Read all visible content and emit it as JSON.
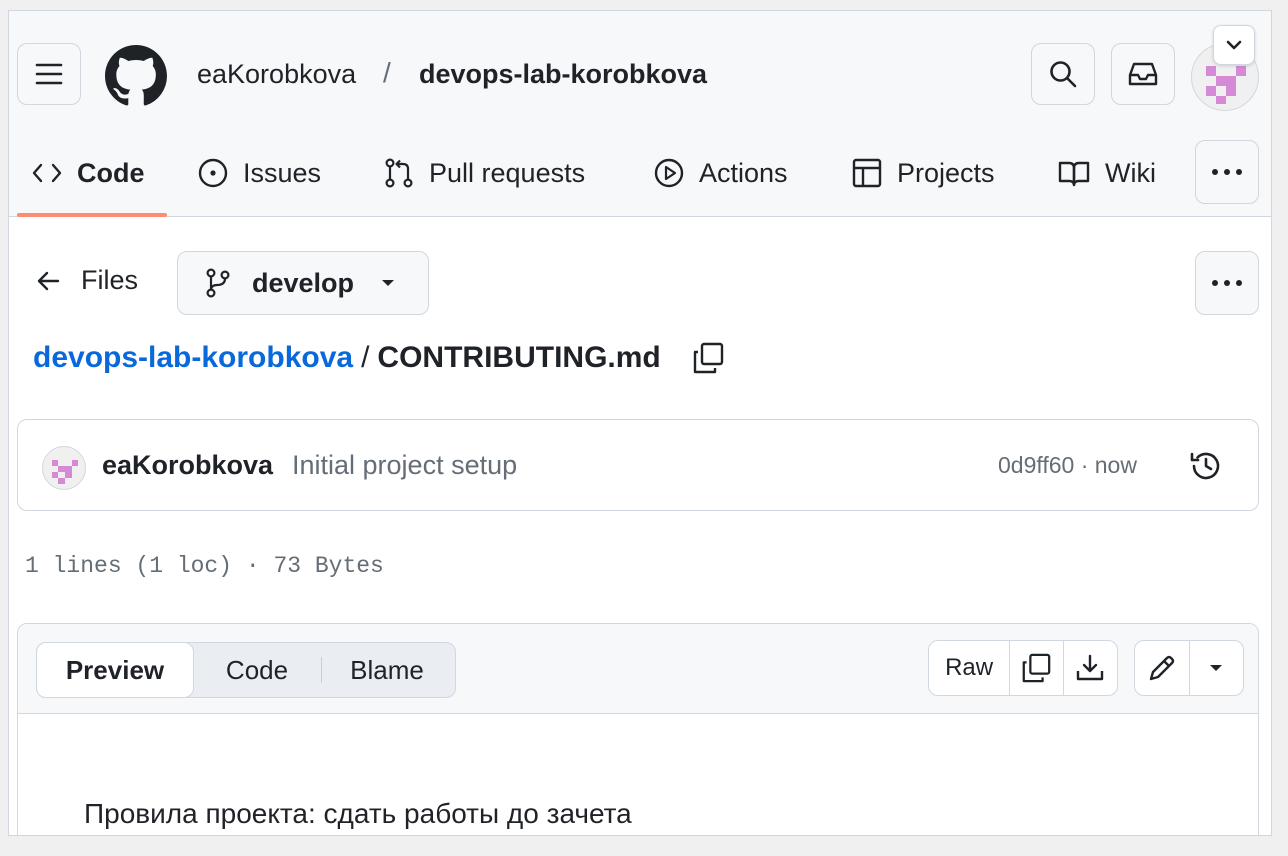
{
  "header": {
    "owner": "eaKorobkova",
    "separator": "/",
    "repo": "devops-lab-korobkova",
    "icons": [
      "hamburger-icon",
      "github-logo-icon",
      "search-icon",
      "inbox-icon",
      "chevron-down-icon"
    ]
  },
  "tabs": [
    {
      "label": "Code",
      "icon": "code-icon",
      "active": true
    },
    {
      "label": "Issues",
      "icon": "issue-icon"
    },
    {
      "label": "Pull requests",
      "icon": "pull-request-icon"
    },
    {
      "label": "Actions",
      "icon": "play-icon"
    },
    {
      "label": "Projects",
      "icon": "table-icon"
    },
    {
      "label": "Wiki",
      "icon": "book-icon"
    }
  ],
  "file_nav": {
    "back_label": "Files",
    "branch": "develop"
  },
  "breadcrumb": {
    "repo": "devops-lab-korobkova",
    "separator": "/",
    "file": "CONTRIBUTING.md"
  },
  "commit": {
    "author": "eaKorobkova",
    "message": "Initial project setup",
    "sha_time": "0d9ff60 · now"
  },
  "file_info": "1 lines (1 loc) · 73 Bytes",
  "viewer": {
    "tabs": [
      "Preview",
      "Code",
      "Blame"
    ],
    "active_tab": "Preview",
    "raw_label": "Raw",
    "content": "Провила проекта: сдать работы до зачета"
  },
  "colors": {
    "link": "#0969da",
    "active_underline": "#fd8c73",
    "avatar_pink": "#d68ad6",
    "border": "#d0d7de"
  }
}
